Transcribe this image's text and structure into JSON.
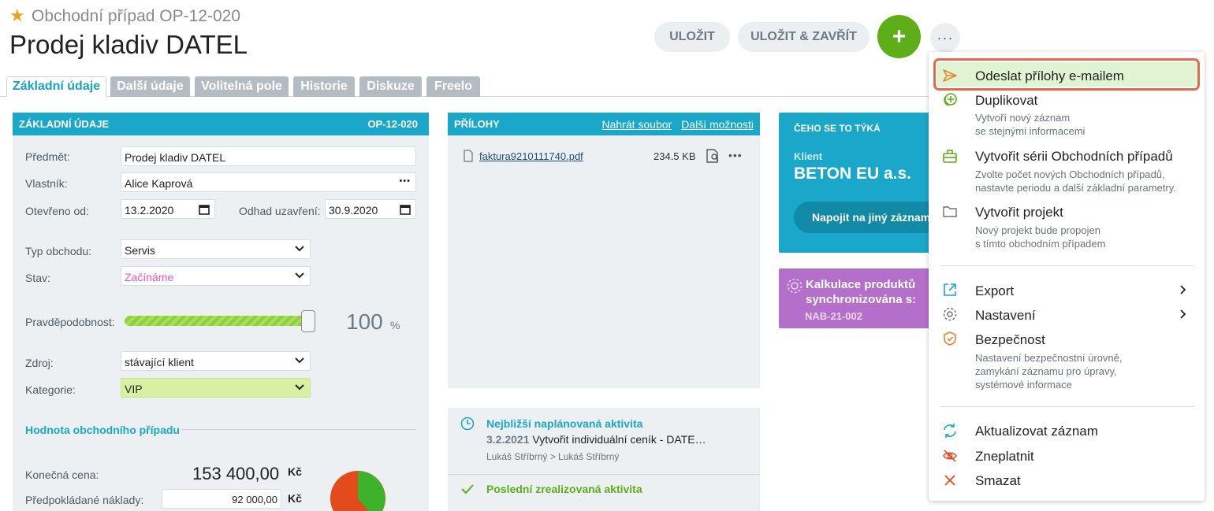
{
  "header": {
    "subtitle": "Obchodní případ  OP-12-020",
    "title": "Prodej kladiv DATEL"
  },
  "toolbar": {
    "save_label": "ULOŽIT",
    "save_close_label": "ULOŽIT & ZAVŘÍT",
    "add_label": "+",
    "more_label": "···"
  },
  "tabs": [
    "Základní údaje",
    "Další údaje",
    "Volitelná pole",
    "Historie",
    "Diskuze",
    "Freelo"
  ],
  "basic": {
    "header": "ZÁKLADNÍ ÚDAJE",
    "code": "OP-12-020",
    "subject_label": "Předmět:",
    "subject_value": "Prodej kladiv DATEL",
    "owner_label": "Vlastník:",
    "owner_value": "Alice Kaprová",
    "owner_more": "•••",
    "opened_label": "Otevřeno od:",
    "opened_value": "13.2.2020",
    "estimate_label": "Odhad uzavření:",
    "estimate_value": "30.9.2020",
    "type_label": "Typ obchodu:",
    "type_value": "Servis",
    "state_label": "Stav:",
    "state_value": "Začínáme",
    "prob_label": "Pravděpodobnost:",
    "prob_value": "100",
    "prob_unit": "%",
    "prob_level": 1.0,
    "source_label": "Zdroj:",
    "source_value": "stávající klient",
    "category_label": "Kategorie:",
    "category_value": "VIP",
    "value_section": "Hodnota obchodního případu",
    "final_price_label": "Konečná cena:",
    "final_price_value": "153 400,00",
    "currency": "Kč",
    "costs_label": "Předpokládané náklady:",
    "costs_value": "92 000,00"
  },
  "attachments": {
    "header": "PŘÍLOHY",
    "upload_link": "Nahrát soubor",
    "more_link": "Další možnosti",
    "file_name": "faktura9210111740.pdf",
    "file_size": "234.5 KB"
  },
  "activity": {
    "next_title": "Nejbližší naplánovaná aktivita",
    "next_date": "3.2.2021",
    "next_text": "Vytvořit individuální ceník - DATE…",
    "next_people": "Lukáš Stříbrný > Lukáš Stříbrný",
    "last_title": "Poslední zrealizovaná aktivita"
  },
  "related": {
    "header": "ČEHO SE TO TÝKÁ",
    "client_label": "Klient",
    "client_name": "BETON EU a.s.",
    "connect_button": "Napojit na jiný záznam"
  },
  "calc": {
    "line1": "Kalkulace produktů",
    "line2": "synchronizována s:",
    "code": "NAB-21-002"
  },
  "menu": {
    "send_email": "Odeslat přílohy e-mailem",
    "duplicate": "Duplikovat",
    "duplicate_sub1": "Vytvoří nový záznam",
    "duplicate_sub2": "se stejnými informacemi",
    "series": "Vytvořit sérii Obchodních případů",
    "series_sub1": "Zvolte počet nových Obchodních případů,",
    "series_sub2": "nastavte periodu a další základní parametry.",
    "project": "Vytvořit projekt",
    "project_sub1": "Nový projekt bude propojen",
    "project_sub2": "s tímto obchodním případem",
    "export": "Export",
    "settings": "Nastavení",
    "security": "Bezpečnost",
    "security_sub1": "Nastavení bezpečnostní úrovně,",
    "security_sub2": "zamykání záznamu pro úpravy,",
    "security_sub3": "systémové informace",
    "refresh": "Aktualizovat záznam",
    "invalidate": "Zneplatnit",
    "delete": "Smazat"
  },
  "colors": {
    "accent": "#1aa7c9",
    "green": "#5dae19",
    "purple": "#b36fc9",
    "highlight": "#e06a4a"
  }
}
